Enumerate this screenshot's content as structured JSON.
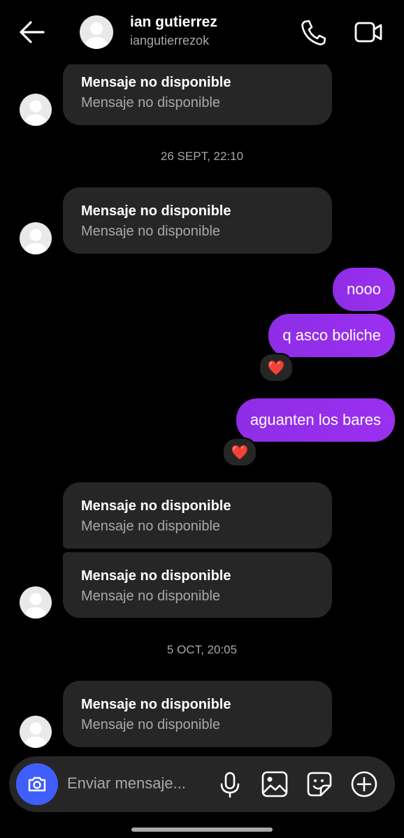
{
  "header": {
    "name": "ian gutierrez",
    "username": "iangutierrezok"
  },
  "messages": {
    "unavailable_title": "Mensaje no disponible",
    "unavailable_body": "Mensaje no disponible"
  },
  "timestamps": [
    "26 SEPT, 22:10",
    "5 OCT, 20:05"
  ],
  "outgoing": [
    {
      "text": "nooo",
      "reaction": ""
    },
    {
      "text": "q asco boliche",
      "reaction": "❤️"
    },
    {
      "text": "aguanten los bares",
      "reaction": "❤️"
    }
  ],
  "composer": {
    "placeholder": "Enviar mensaje..."
  },
  "colors": {
    "background": "#000000",
    "incoming_bubble": "#262626",
    "outgoing_bubble": "#9330eb",
    "camera_button": "#3f5efb"
  }
}
